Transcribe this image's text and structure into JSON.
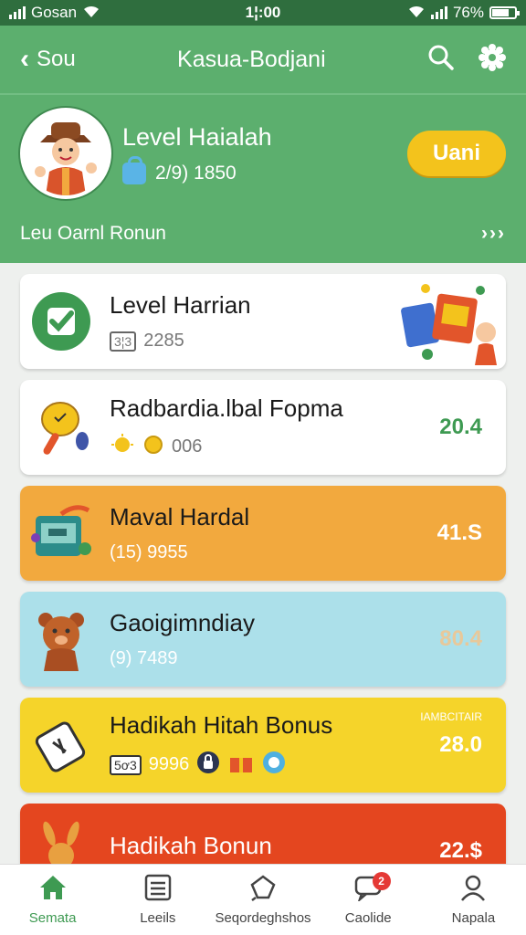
{
  "status": {
    "carrier": "Gosan",
    "time": "1¦:00",
    "battery": "76%",
    "battery_level": 0.76
  },
  "header": {
    "back_label": "Sou",
    "title": "Kasua-Bodjani",
    "icons": [
      "search-icon",
      "gear-icon"
    ],
    "colors": {
      "primary": "#5caf6e",
      "accent": "#f3c31c"
    }
  },
  "profile": {
    "name": "Level Haialah",
    "code": "2/9) 1850",
    "button_label": "Uani"
  },
  "bonus_line": {
    "label": "Leu Oarnl Ronun",
    "more": "›››"
  },
  "cards": [
    {
      "title": "Level Harrian",
      "sub_chip": "3¦3",
      "sub": "2285",
      "value": ""
    },
    {
      "title": "Radbardia.lbal Fopma",
      "sub_chip": "",
      "sub": "006",
      "value": "20.4"
    },
    {
      "title": "Maval Hardal",
      "sub_chip": "",
      "sub": "(15) 9955",
      "value": "41.S"
    },
    {
      "title": "Gaoigimndiay",
      "sub_chip": "",
      "sub": "(9) 7489",
      "value": "80.4"
    },
    {
      "title": "Hadikah Hitah Bonus",
      "sub_chip": "5ơ3",
      "sub": "9996",
      "value": "28.0",
      "tag": "IAMBCITAIR"
    },
    {
      "title": "Hadikah Bonun",
      "sub_chip": "",
      "sub": "",
      "value": "22.$"
    }
  ],
  "nav": [
    {
      "label": "Semata",
      "icon": "home-icon"
    },
    {
      "label": "Leeils",
      "icon": "list-icon"
    },
    {
      "label": "Seqordeghshos",
      "icon": "chat-icon"
    },
    {
      "label": "Caolide",
      "icon": "message-icon",
      "badge": "2"
    },
    {
      "label": "Napala",
      "icon": "profile-icon"
    }
  ]
}
